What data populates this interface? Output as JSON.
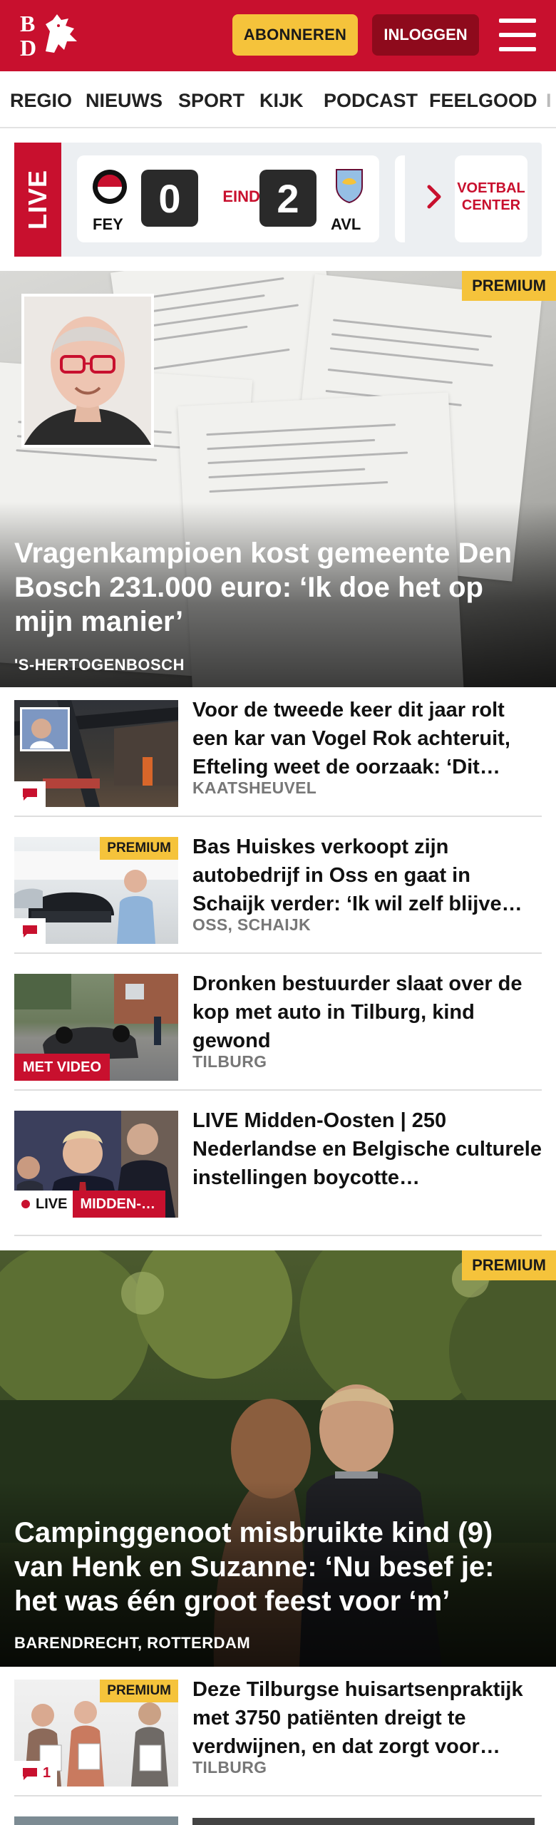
{
  "header": {
    "logo_text": "BD",
    "subscribe_label": "ABONNEREN",
    "login_label": "INLOGGEN"
  },
  "nav": {
    "items": [
      "REGIO",
      "NIEUWS",
      "SPORT",
      "KIJK",
      "PODCAST",
      "FEELGOOD"
    ]
  },
  "live_bar": {
    "tag": "LIVE",
    "home_team": "FEY",
    "home_score": "0",
    "status": "EINDE",
    "away_score": "2",
    "away_team": "AVL",
    "voetbal_line1": "VOETBAL",
    "voetbal_line2": "CENTER"
  },
  "hero1": {
    "badge": "PREMIUM",
    "title": "Vragenkampioen kost gemeente Den Bosch 231.000 euro: ‘Ik doe het op mijn manier’",
    "location": "'S-HERTOGENBOSCH"
  },
  "articles": [
    {
      "title": "Voor de tweede keer dit jaar rolt een kar van Vogel Rok achteruit, Efteling weet de oorzaak: ‘Dit…",
      "location": "KAATSHEUVEL"
    },
    {
      "badge": "PREMIUM",
      "title": "Bas Huiskes verkoopt zijn autobedrijf in Oss en gaat in Schaijk verder: ‘Ik wil zelf blijve…",
      "location": "OSS, SCHAIJK"
    },
    {
      "video_label": "MET VIDEO",
      "title": "Dronken bestuurder slaat over de kop met auto in Tilburg, kind gewond",
      "location": "TILBURG"
    },
    {
      "live_label": "LIVE",
      "category": "MIDDEN-…",
      "title": "LIVE Midden-Oosten | 250 Nederlandse en Belgische culturele instellingen boycotte…"
    }
  ],
  "hero2": {
    "badge": "PREMIUM",
    "title": "Campinggenoot misbruikte kind (9) van Henk en Suzanne: ‘Nu besef je: het was één groot feest voor ‘m’",
    "location": "BARENDRECHT, ROTTERDAM"
  },
  "article5": {
    "badge": "PREMIUM",
    "comment_count": "1",
    "title": "Deze Tilburgse huisartsenprak­tijk met 3750 patiënten dreigt te verdwijnen, en dat zorgt voor…",
    "location": "TILBURG"
  },
  "colors": {
    "brand_red": "#c8102e",
    "premium_yellow": "#f5c33b",
    "login_dark_red": "#8e0a1c"
  }
}
